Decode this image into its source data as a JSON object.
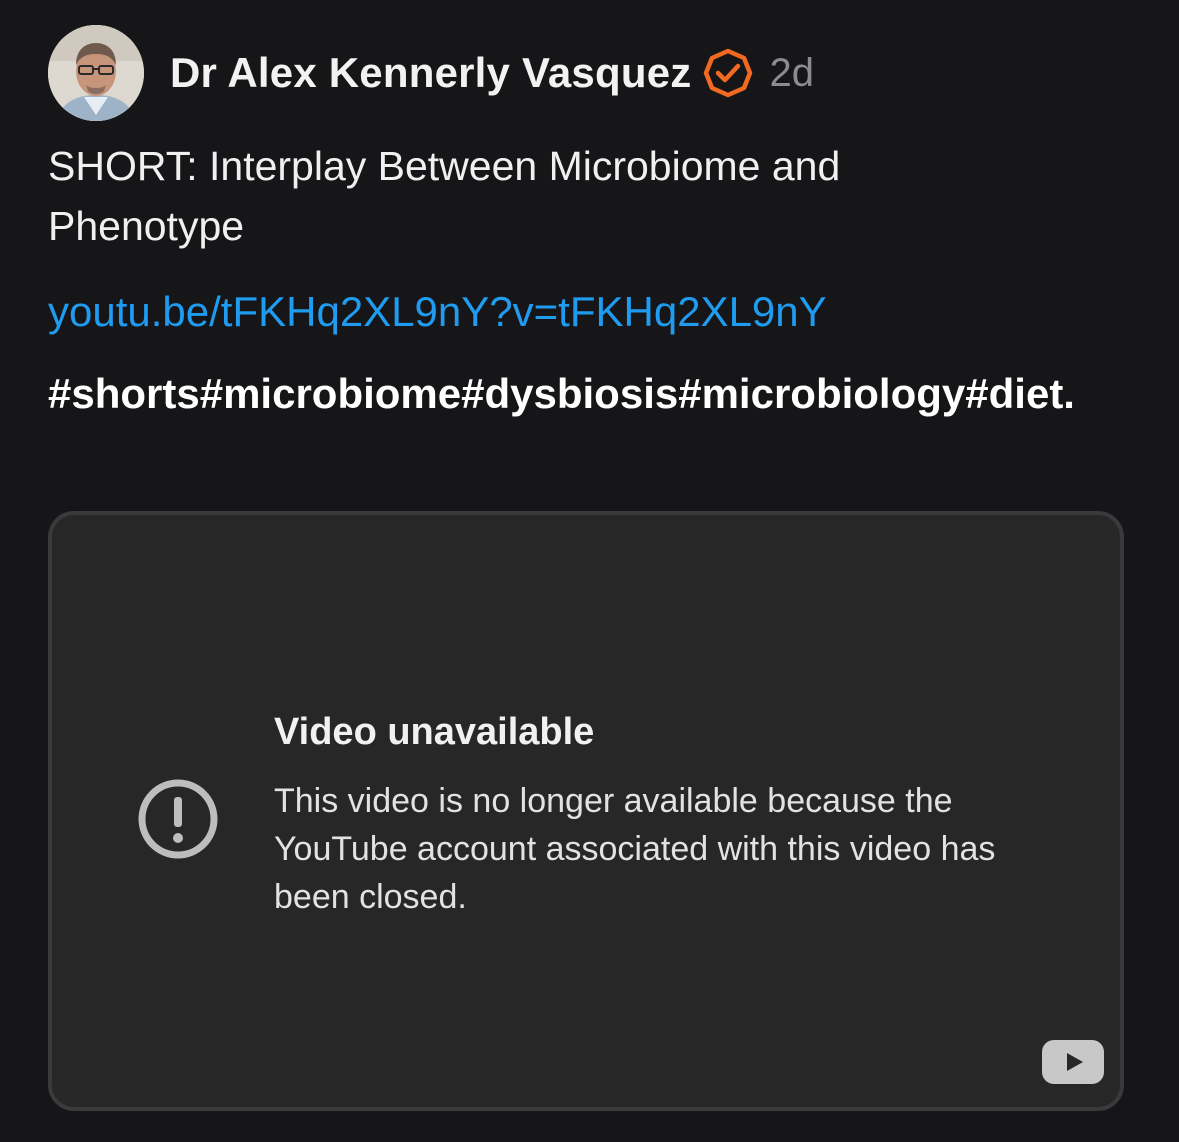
{
  "post": {
    "author": {
      "name": "Dr Alex Kennerly Vasquez",
      "avatar_icon": "author-avatar",
      "verified_icon": "verified-badge-icon",
      "verified_color": "#f26a21"
    },
    "timestamp": "2d",
    "title": "SHORT: Interplay Between Microbiome and Phenotype",
    "link": "youtu.be/tFKHq2XL9nY?v=tFKHq2XL9nY",
    "hashtags": "#shorts#microbiome#dysbiosis#microbiology#diet."
  },
  "video": {
    "error_title": "Video unavailable",
    "error_message": "This video is no longer available because the YouTube account associated with this video has been closed.",
    "alert_icon": "exclamation-circle-icon",
    "youtube_icon": "youtube-play-icon"
  },
  "colors": {
    "background": "#161618",
    "link": "#1f9bf0",
    "timestamp": "#8c8c90",
    "card": "#272727",
    "card_border": "#3a3a3d"
  }
}
